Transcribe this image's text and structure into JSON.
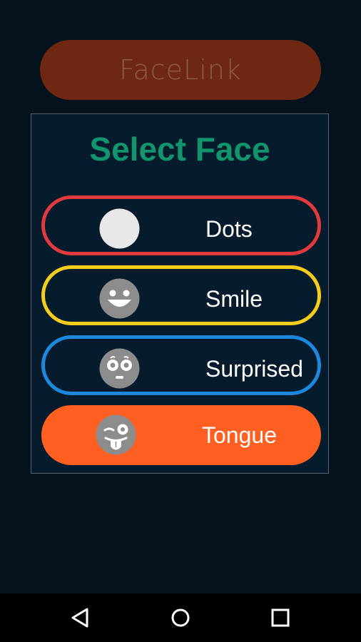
{
  "app": {
    "title": "FaceLink"
  },
  "dialog": {
    "title": "Select Face",
    "options": [
      {
        "label": "Dots",
        "face_icon": "dots-face-icon",
        "border_color": "#e03a3f"
      },
      {
        "label": "Smile",
        "face_icon": "smile-face-icon",
        "border_color": "#f5cd1a"
      },
      {
        "label": "Surprised",
        "face_icon": "surprised-face-icon",
        "border_color": "#1d88dc"
      },
      {
        "label": "Tongue",
        "face_icon": "tongue-face-icon",
        "fill_color": "#ff6021",
        "selected": true
      }
    ]
  },
  "colors": {
    "background": "#03121c",
    "dialog_bg": "#061b2b",
    "title_green": "#12946c",
    "top_pill": "#6e2710"
  },
  "navbar": {
    "buttons": [
      "back-icon",
      "home-icon",
      "recents-icon"
    ]
  }
}
